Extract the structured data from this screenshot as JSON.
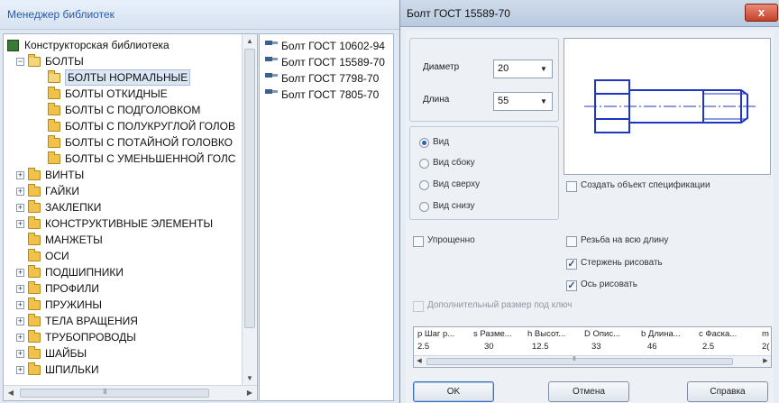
{
  "manager": {
    "title": "Менеджер библиотек",
    "tree": [
      {
        "label": "Конструкторская библиотека",
        "level": 0,
        "icon": "library-icon",
        "expander": "none"
      },
      {
        "label": "БОЛТЫ",
        "level": 1,
        "icon": "folder-open-icon",
        "expander": "minus"
      },
      {
        "label": "БОЛТЫ НОРМАЛЬНЫЕ",
        "level": 2,
        "icon": "folder-open-icon",
        "expander": "none",
        "selected": true
      },
      {
        "label": "БОЛТЫ ОТКИДНЫЕ",
        "level": 2,
        "icon": "folder-icon",
        "expander": "none"
      },
      {
        "label": "БОЛТЫ С ПОДГОЛОВКОМ",
        "level": 2,
        "icon": "folder-icon",
        "expander": "none"
      },
      {
        "label": "БОЛТЫ С ПОЛУКРУГЛОЙ ГОЛОВ",
        "level": 2,
        "icon": "folder-icon",
        "expander": "none"
      },
      {
        "label": "БОЛТЫ С ПОТАЙНОЙ ГОЛОВКО",
        "level": 2,
        "icon": "folder-icon",
        "expander": "none"
      },
      {
        "label": "БОЛТЫ С УМЕНЬШЕННОЙ ГОЛС",
        "level": 2,
        "icon": "folder-icon",
        "expander": "none"
      },
      {
        "label": "ВИНТЫ",
        "level": 1,
        "icon": "folder-icon",
        "expander": "plus"
      },
      {
        "label": "ГАЙКИ",
        "level": 1,
        "icon": "folder-icon",
        "expander": "plus"
      },
      {
        "label": "ЗАКЛЕПКИ",
        "level": 1,
        "icon": "folder-icon",
        "expander": "plus"
      },
      {
        "label": "КОНСТРУКТИВНЫЕ ЭЛЕМЕНТЫ",
        "level": 1,
        "icon": "folder-icon",
        "expander": "plus"
      },
      {
        "label": "МАНЖЕТЫ",
        "level": 1,
        "icon": "folder-icon",
        "expander": "none"
      },
      {
        "label": "ОСИ",
        "level": 1,
        "icon": "folder-icon",
        "expander": "none"
      },
      {
        "label": "ПОДШИПНИКИ",
        "level": 1,
        "icon": "folder-icon",
        "expander": "plus"
      },
      {
        "label": "ПРОФИЛИ",
        "level": 1,
        "icon": "folder-icon",
        "expander": "plus"
      },
      {
        "label": "ПРУЖИНЫ",
        "level": 1,
        "icon": "folder-icon",
        "expander": "plus"
      },
      {
        "label": "ТЕЛА ВРАЩЕНИЯ",
        "level": 1,
        "icon": "folder-icon",
        "expander": "plus"
      },
      {
        "label": "ТРУБОПРОВОДЫ",
        "level": 1,
        "icon": "folder-icon",
        "expander": "plus"
      },
      {
        "label": "ШАЙБЫ",
        "level": 1,
        "icon": "folder-icon",
        "expander": "plus"
      },
      {
        "label": "ШПИЛЬКИ",
        "level": 1,
        "icon": "folder-icon",
        "expander": "plus"
      }
    ],
    "items": [
      "Болт ГОСТ 10602-94",
      "Болт ГОСТ 15589-70",
      "Болт ГОСТ 7798-70",
      "Болт ГОСТ 7805-70"
    ],
    "scroll_grip": "III"
  },
  "dialog": {
    "title": "Болт ГОСТ 15589-70",
    "close": "x",
    "diameter": {
      "label": "Диаметр",
      "value": "20"
    },
    "length": {
      "label": "Длина",
      "value": "55"
    },
    "views": [
      {
        "label": "Вид",
        "checked": true
      },
      {
        "label": "Вид сбоку",
        "checked": false
      },
      {
        "label": "Вид сверху",
        "checked": false
      },
      {
        "label": "Вид снизу",
        "checked": false
      }
    ],
    "create_spec": {
      "label": "Создать объект спецификации",
      "checked": false
    },
    "simplified": {
      "label": "Упрощенно",
      "checked": false
    },
    "thread_full": {
      "label": "Резьба на всю длину",
      "checked": false
    },
    "draw_rod": {
      "label": "Стержень рисовать",
      "checked": true
    },
    "draw_axis": {
      "label": "Ось рисовать",
      "checked": true
    },
    "extra_size": {
      "label": "Дополнительный размер под ключ",
      "checked": false,
      "disabled": true
    },
    "grid": {
      "headers": [
        "p Шаг р...",
        "s Разме...",
        "h Высот...",
        "D Опис...",
        "b Длина...",
        "c Фаска...",
        "m"
      ],
      "values": [
        "2.5",
        "30",
        "12.5",
        "33",
        "46",
        "2.5",
        "2("
      ],
      "scroll_grip": "III"
    },
    "buttons": {
      "ok": "OK",
      "cancel": "Отмена",
      "help": "Справка"
    },
    "colors": {
      "drawing": "#1f35c4",
      "accent": "#2e63b4"
    }
  }
}
